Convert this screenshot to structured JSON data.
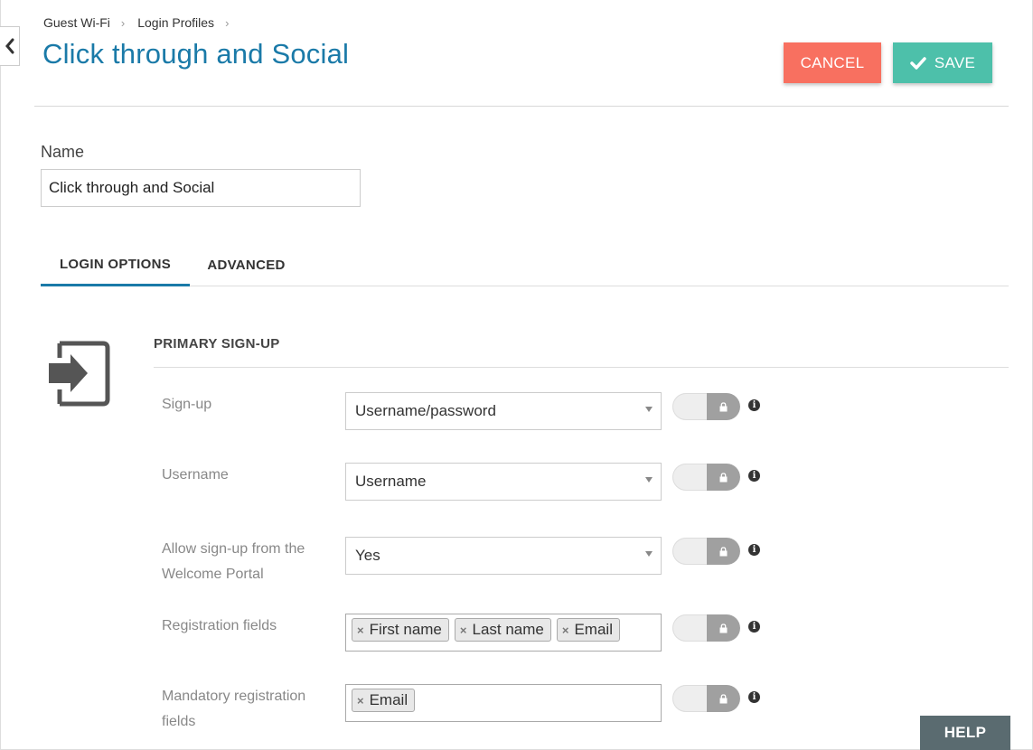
{
  "breadcrumb": [
    {
      "label": "Guest Wi-Fi"
    },
    {
      "label": "Login Profiles"
    }
  ],
  "page": {
    "title": "Click through and Social"
  },
  "actions": {
    "cancel_label": "CANCEL",
    "save_label": "SAVE"
  },
  "form": {
    "name_label": "Name",
    "name_value": "Click through and Social"
  },
  "tabs": [
    {
      "label": "LOGIN OPTIONS",
      "active": true
    },
    {
      "label": "ADVANCED",
      "active": false
    }
  ],
  "section": {
    "title": "PRIMARY SIGN-UP",
    "icon": "sign-in-icon"
  },
  "rows": {
    "signup": {
      "label": "Sign-up",
      "value": "Username/password"
    },
    "username": {
      "label": "Username",
      "value": "Username"
    },
    "allow_signup": {
      "label": "Allow sign-up from the Welcome Portal",
      "value": "Yes"
    },
    "registration_fields": {
      "label": "Registration fields",
      "tags": [
        "First name",
        "Last name",
        "Email"
      ]
    },
    "mandatory_fields": {
      "label": "Mandatory registration fields",
      "tags": [
        "Email"
      ]
    }
  },
  "help": {
    "label": "HELP"
  },
  "colors": {
    "title": "#1a7aa8",
    "cancel": "#f87060",
    "save": "#4dc0aa",
    "tab_underline": "#1a7aa8",
    "help": "#5a6b70"
  }
}
